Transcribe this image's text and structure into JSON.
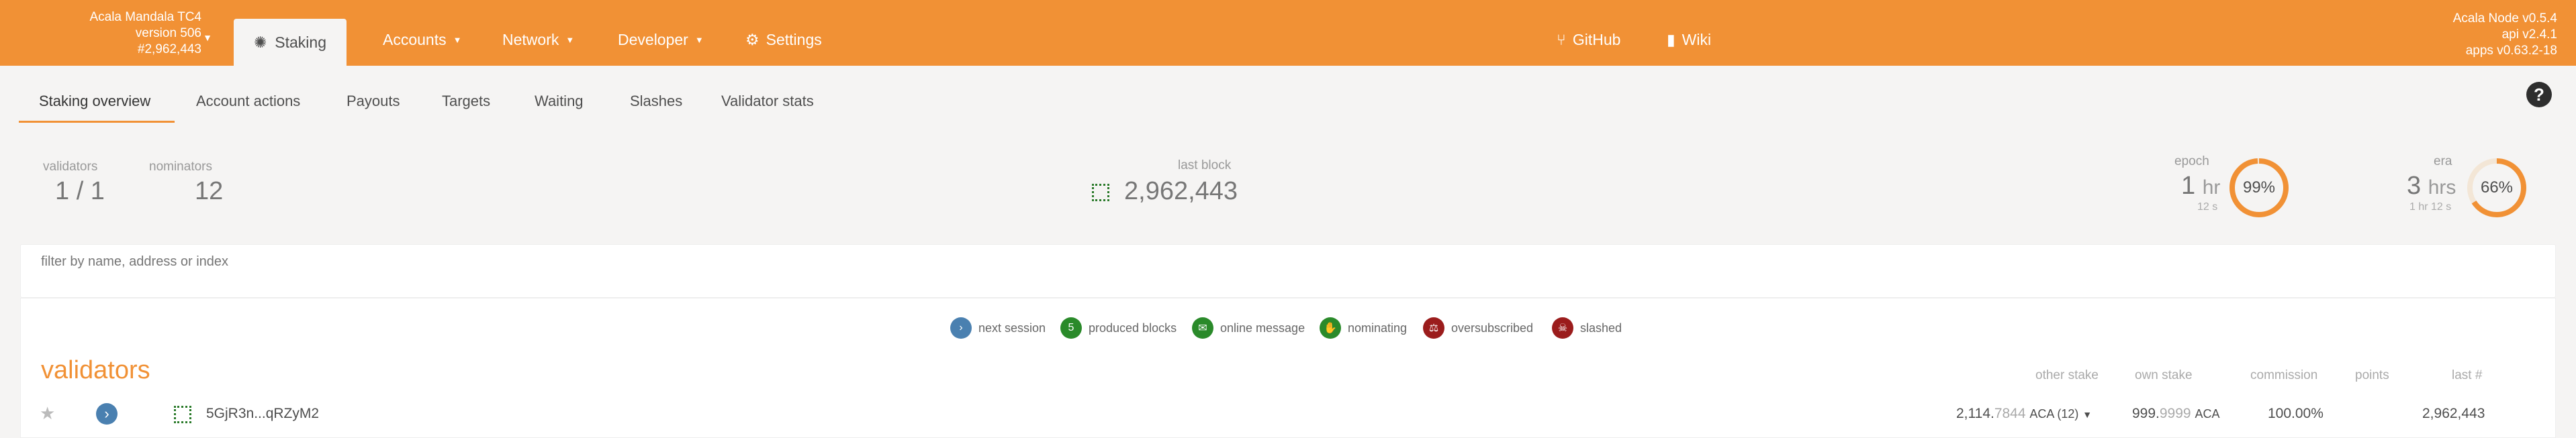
{
  "header": {
    "chain_name": "Acala Mandala TC4",
    "chain_version": "version 506",
    "best_block": "#2,962,443",
    "active_tab": "Staking",
    "nav": {
      "accounts": "Accounts",
      "network": "Network",
      "developer": "Developer",
      "settings": "Settings",
      "github": "GitHub",
      "wiki": "Wiki"
    },
    "node_name": "Acala Node v0.5.4",
    "api_version": "api v2.4.1",
    "apps_version": "apps v0.63.2-18"
  },
  "subtabs": [
    "Staking overview",
    "Account actions",
    "Payouts",
    "Targets",
    "Waiting",
    "Slashes",
    "Validator stats"
  ],
  "summary": {
    "validators_label": "validators",
    "validators_value": "1 / 1",
    "nominators_label": "nominators",
    "nominators_value": "12",
    "last_block_label": "last block",
    "last_block_value": "2,962,443",
    "epoch_label": "epoch",
    "epoch_value": "1",
    "epoch_unit": "hr",
    "epoch_sub": "12 s",
    "epoch_percent": "99%",
    "epoch_fraction": 0.99,
    "era_label": "era",
    "era_value": "3",
    "era_unit": "hrs",
    "era_sub": "1 hr 12 s",
    "era_percent": "66%",
    "era_fraction": 0.66
  },
  "filter": {
    "placeholder": "filter by name, address or index"
  },
  "legend": [
    {
      "glyph": "›",
      "label": "next session",
      "color": "#4a80b0"
    },
    {
      "glyph": "5",
      "label": "produced blocks",
      "color": "#2a8a2a"
    },
    {
      "glyph": "✉",
      "label": "online message",
      "color": "#2a8a2a"
    },
    {
      "glyph": "✋",
      "label": "nominating",
      "color": "#2a8a2a"
    },
    {
      "glyph": "⚖",
      "label": "oversubscribed",
      "color": "#9b1c1c"
    },
    {
      "glyph": "☠",
      "label": "slashed",
      "color": "#9b1c1c"
    }
  ],
  "validators": {
    "title": "validators",
    "columns": {
      "other_stake": "other stake",
      "own_stake": "own stake",
      "commission": "commission",
      "points": "points",
      "last": "last #"
    },
    "row": {
      "address": "5GjR3n...qRZyM2",
      "other_stake_int": "2,114.",
      "other_stake_dec": "7844",
      "other_stake_unit": "ACA (12)",
      "own_stake_int": "999.",
      "own_stake_dec": "9999",
      "own_stake_unit": "ACA",
      "commission": "100.00%",
      "points": "",
      "last_block": "2,962,443"
    }
  },
  "colors": {
    "accent": "#f19135",
    "header_text": "#ffffff"
  }
}
